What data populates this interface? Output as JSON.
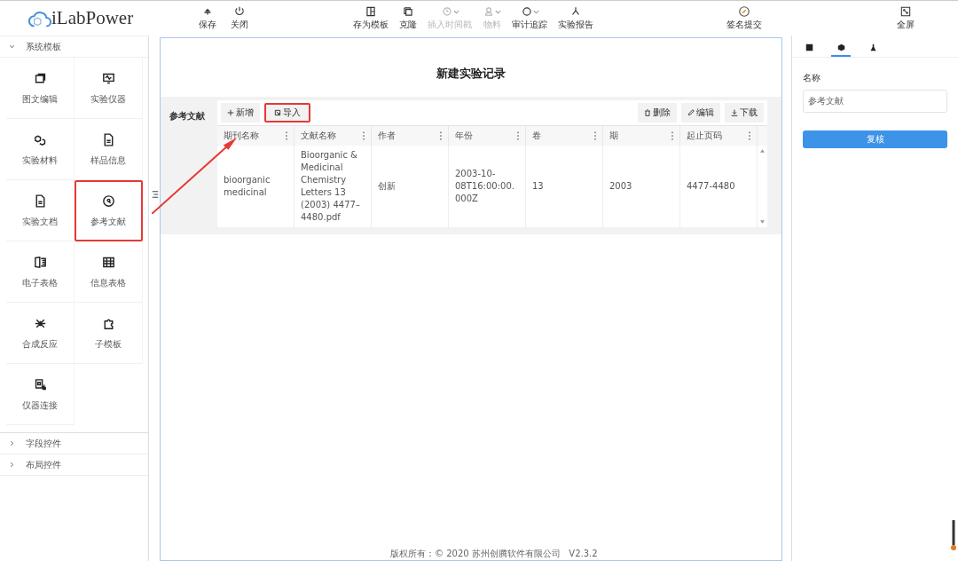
{
  "logo": "iLabPower",
  "toolbar_left": [
    {
      "label": "保存",
      "disabled": false
    },
    {
      "label": "关闭",
      "disabled": false
    }
  ],
  "toolbar_center": [
    {
      "label": "存为模板",
      "disabled": false,
      "dropdown": false
    },
    {
      "label": "克隆",
      "disabled": false,
      "dropdown": false
    },
    {
      "label": "插入时间戳",
      "disabled": true,
      "dropdown": true
    },
    {
      "label": "物料",
      "disabled": true,
      "dropdown": true
    },
    {
      "label": "审计追踪",
      "disabled": false,
      "dropdown": true
    },
    {
      "label": "实验报告",
      "disabled": false,
      "dropdown": false
    }
  ],
  "sign_button": "签名提交",
  "fullscreen_button": "全屏",
  "sidebar": [
    {
      "label": "系统模板",
      "expanded": true,
      "items": [
        {
          "label": "图文编辑",
          "highlighted": false
        },
        {
          "label": "实验仪器",
          "highlighted": false
        },
        {
          "label": "实验材料",
          "highlighted": false
        },
        {
          "label": "样品信息",
          "highlighted": false
        },
        {
          "label": "实验文档",
          "highlighted": false
        },
        {
          "label": "参考文献",
          "highlighted": true
        },
        {
          "label": "电子表格",
          "highlighted": false
        },
        {
          "label": "信息表格",
          "highlighted": false
        },
        {
          "label": "合成反应",
          "highlighted": false
        },
        {
          "label": "子模板",
          "highlighted": false
        },
        {
          "label": "仪器连接",
          "highlighted": false
        }
      ]
    },
    {
      "label": "字段控件",
      "expanded": false
    },
    {
      "label": "布局控件",
      "expanded": false
    }
  ],
  "document": {
    "title": "新建实验记录",
    "section": {
      "label": "参考文献",
      "left_buttons": [
        {
          "label": "新增",
          "highlighted": false
        },
        {
          "label": "导入",
          "highlighted": true
        }
      ],
      "right_buttons": [
        {
          "label": "删除"
        },
        {
          "label": "编辑"
        },
        {
          "label": "下载"
        }
      ],
      "columns": [
        "期刊名称",
        "文献名称",
        "作者",
        "年份",
        "卷",
        "期",
        "起止页码"
      ],
      "rows": [
        [
          "bioorganic medicinal",
          "Bioorganic & Medicinal Chemistry Letters 13 (2003) 4477–4480.pdf",
          "创新",
          "2003-10-08T16:00:00.000Z",
          "13",
          "2003",
          "4477-4480"
        ]
      ]
    }
  },
  "right_panel": {
    "tabs": [
      {
        "selected": false
      },
      {
        "selected": true
      },
      {
        "selected": false
      }
    ],
    "field_label": "名称",
    "field_value": "参考文献",
    "button": "复核"
  },
  "footer": "版权所有：© 2020 苏州创腾软件有限公司   V2.3.2"
}
